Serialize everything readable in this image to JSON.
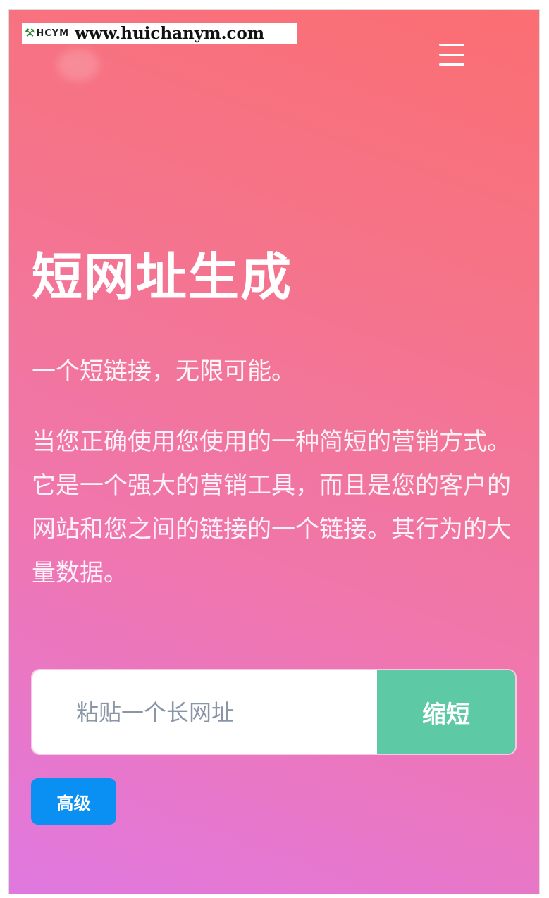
{
  "watermark": {
    "logo_icon": "shovel-icon",
    "brand": "HCYM",
    "url": "www.huichanym.com"
  },
  "header": {
    "menu_icon": "hamburger-menu-icon"
  },
  "hero": {
    "title": "短网址生成",
    "tagline": "一个短链接，无限可能。",
    "description": "当您正确使用您使用的一种简短的营销方式。它是一个强大的营销工具，而且是您的客户的网站和您之间的链接的一个链接。其行为的大量数据。"
  },
  "form": {
    "input_placeholder": "粘贴一个长网址",
    "input_value": "",
    "submit_label": "缩短",
    "advanced_label": "高级"
  },
  "colors": {
    "gradient_top": "#fb6e72",
    "gradient_bottom": "#e078e0",
    "submit_button": "#5ec9a5",
    "advanced_button": "#0a8ff2",
    "text": "#ffffff"
  }
}
